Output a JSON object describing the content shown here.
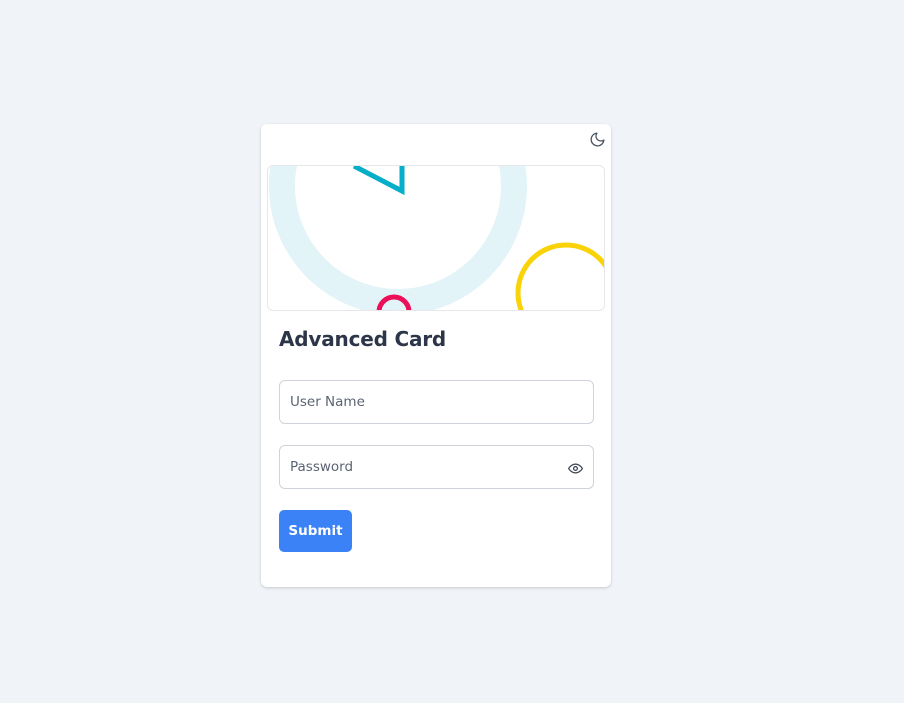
{
  "card": {
    "title": "Advanced Card"
  },
  "theme_toggle": {
    "icon": "moon-icon"
  },
  "form": {
    "username": {
      "placeholder": "User Name",
      "value": ""
    },
    "password": {
      "placeholder": "Password",
      "value": "",
      "toggle_icon": "eye-icon"
    },
    "submit_label": "Submit"
  },
  "colors": {
    "background": "#f0f3f7",
    "card": "#ffffff",
    "title": "#2d3648",
    "primary": "#3b82f6",
    "hero_ring": "#e2f4f7",
    "hero_triangle": "#06aec9",
    "hero_pink": "#ec0f5a",
    "hero_yellow": "#f9d308"
  }
}
